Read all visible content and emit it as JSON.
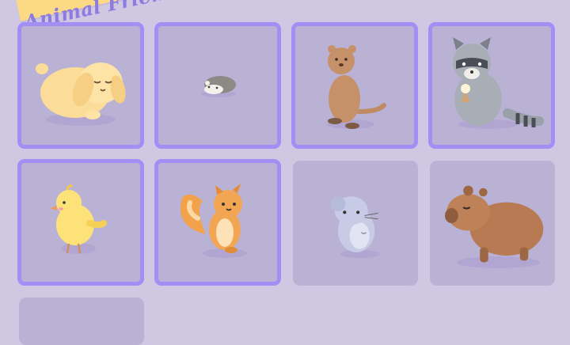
{
  "header": {
    "title": "Animal Friends"
  },
  "cards": [
    {
      "animal": "bunny",
      "icon": "bunny-icon",
      "selected": true
    },
    {
      "animal": "hamster",
      "icon": "hamster-icon",
      "selected": true
    },
    {
      "animal": "quokka",
      "icon": "quokka-icon",
      "selected": true
    },
    {
      "animal": "raccoon",
      "icon": "raccoon-icon",
      "selected": true
    },
    {
      "animal": "chick",
      "icon": "chick-icon",
      "selected": true
    },
    {
      "animal": "squirrel",
      "icon": "squirrel-icon",
      "selected": true
    },
    {
      "animal": "chinchilla",
      "icon": "chinchilla-icon",
      "selected": false
    },
    {
      "animal": "capybara",
      "icon": "capybara-icon",
      "selected": false
    },
    {
      "animal": "",
      "icon": "",
      "selected": false
    }
  ],
  "colors": {
    "background": "#d0c7e3",
    "card": "#bab2d5",
    "selected_border": "#a28ef4",
    "banner": "#fcd985",
    "banner_text": "#8c7ce0"
  }
}
